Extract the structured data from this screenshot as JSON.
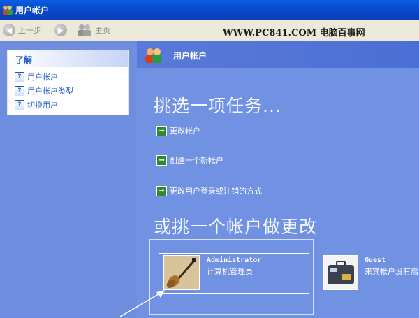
{
  "window": {
    "title": "用户帐户"
  },
  "toolbar": {
    "back_label": "上一步",
    "home_label": "主页",
    "watermark": "WWW.PC841.COM 电脑百事网"
  },
  "sidebar": {
    "header": "了解",
    "items": [
      {
        "label": "用户帐户"
      },
      {
        "label": "用户帐户类型"
      },
      {
        "label": "切换用户"
      }
    ]
  },
  "main": {
    "header_title": "用户帐户",
    "pick_task": "挑选一项任务...",
    "tasks": [
      {
        "label": "更改帐户"
      },
      {
        "label": "创建一个新帐户"
      },
      {
        "label": "更改用户登录或注销的方式"
      }
    ],
    "pick_account": "或挑一个帐户做更改",
    "accounts": [
      {
        "name": "Administrator",
        "description": "计算机管理员"
      },
      {
        "name": "Guest",
        "description": "来宾帐户没有启"
      }
    ]
  },
  "colors": {
    "title_bar": "#0a5fe0",
    "main_background": "#7191e2",
    "link_blue": "#215dc6"
  }
}
